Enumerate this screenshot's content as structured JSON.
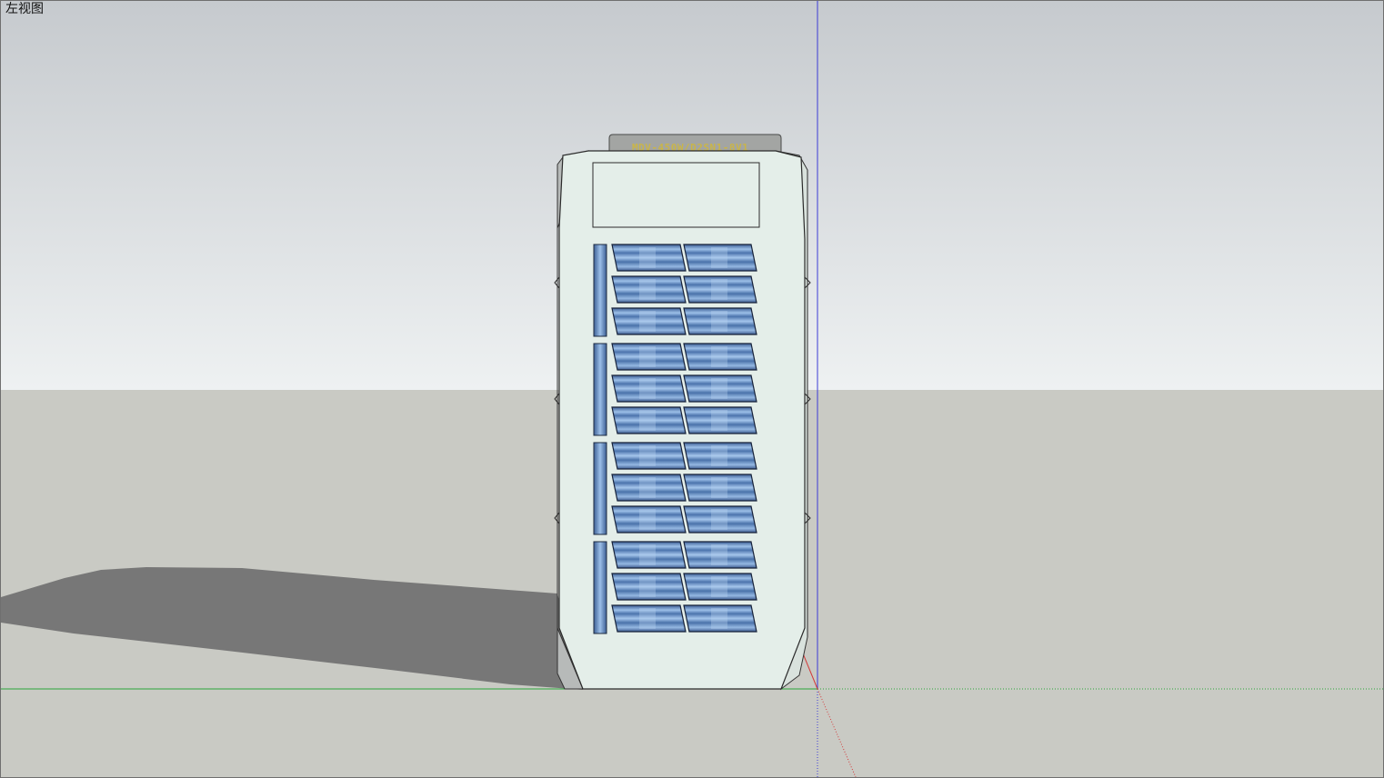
{
  "viewport": {
    "view_label": "左视图"
  },
  "model": {
    "label_plate_text": "MDV-450W/D2SN1-8V1",
    "colors": {
      "sky_top": "#c7cbcf",
      "sky_bottom": "#edf0f1",
      "ground": "#c9cac4",
      "shadow": "#7a7a7a",
      "body": "#e5efea",
      "side_panel": "#b9bcbb",
      "grille_blue": "#4f76ad",
      "grille_light": "#8fb2df",
      "label_plate": "#a3a5a3",
      "label_text": "#c9b54a"
    }
  },
  "axes": {
    "blue_axis": "#3b3bd6",
    "green_axis": "#2aa53a",
    "red_axis": "#d33a3a"
  }
}
